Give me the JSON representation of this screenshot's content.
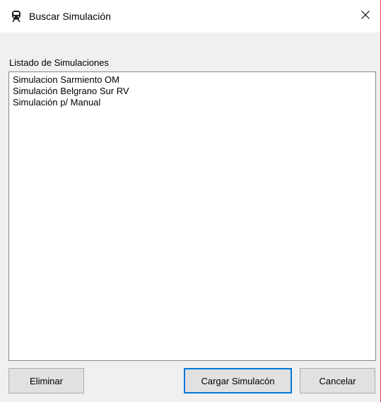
{
  "window": {
    "title": "Buscar Simulación",
    "icon": "train-icon",
    "close_icon": "close-icon"
  },
  "list": {
    "label": "Listado de Simulaciones",
    "items": [
      "Simulacion Sarmiento OM",
      "Simulación Belgrano Sur RV",
      "Simulación p/ Manual"
    ]
  },
  "buttons": {
    "eliminar": "Eliminar",
    "cargar": "Cargar Simulacón",
    "cancelar": "Cancelar"
  },
  "colors": {
    "accent": "#0078d7",
    "window_bg": "#f0f0f0",
    "border_accent": "#e04a4a"
  }
}
